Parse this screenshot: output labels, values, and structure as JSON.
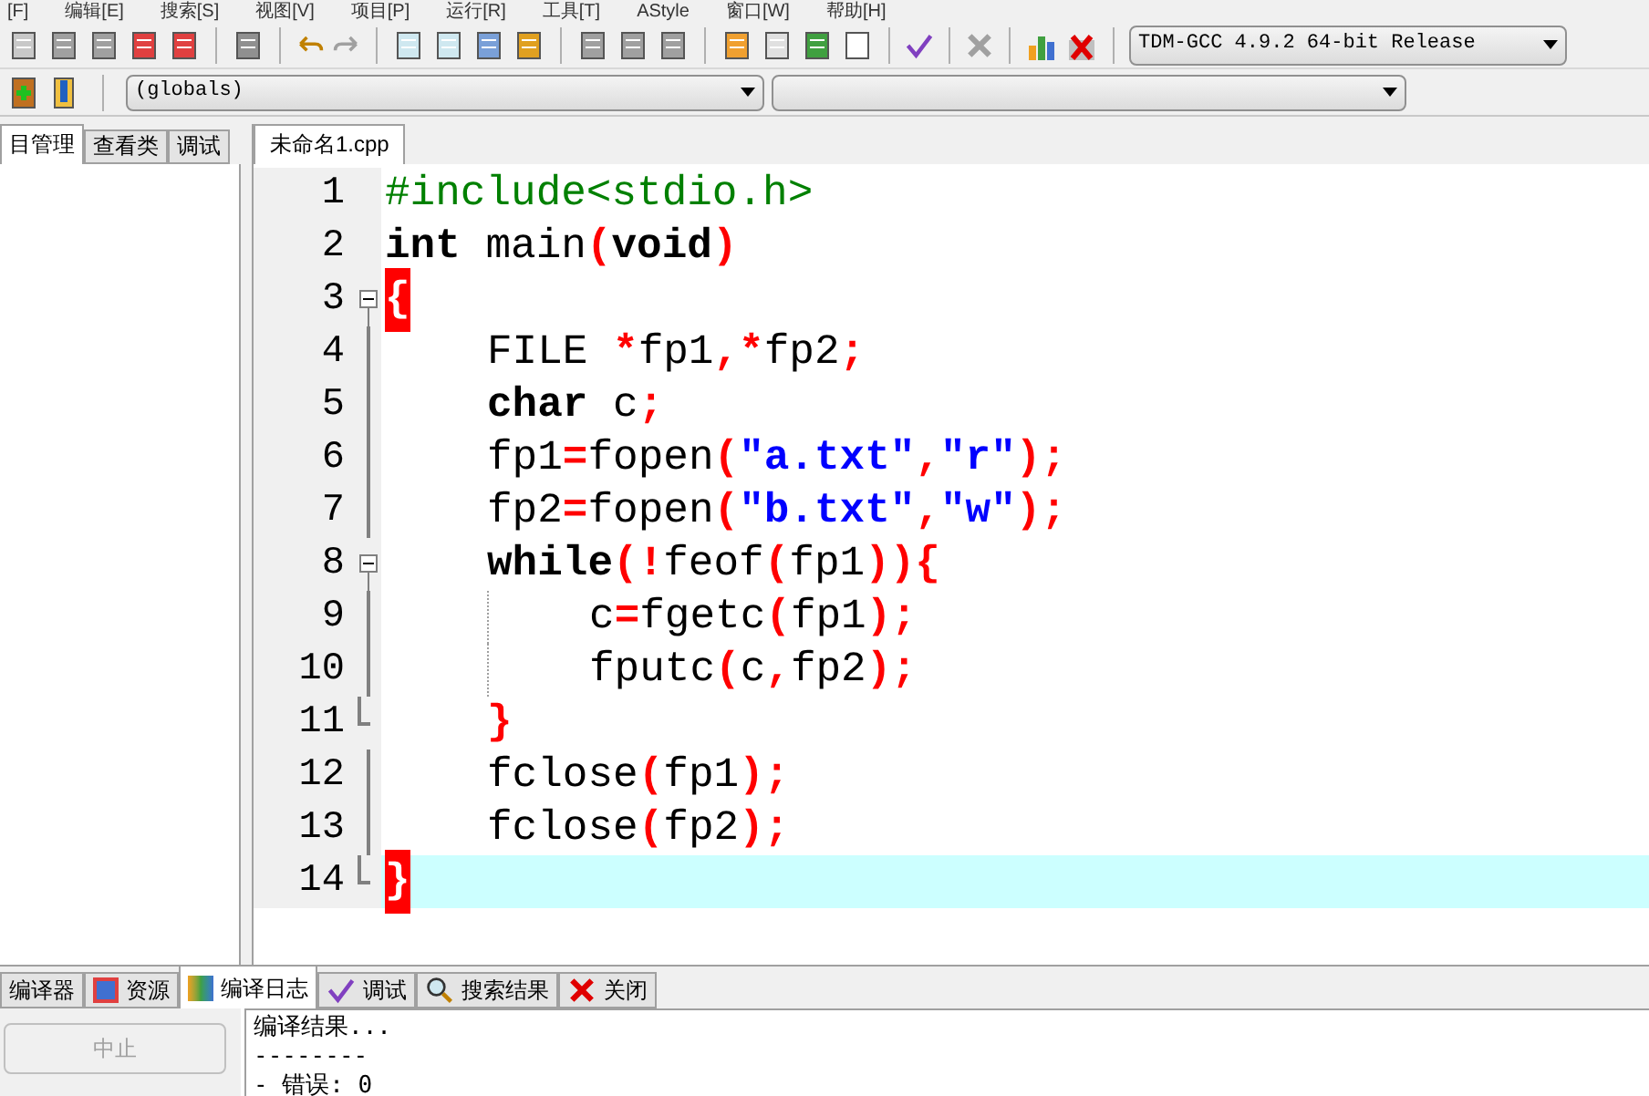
{
  "menu": [
    "[F]",
    "编辑[E]",
    "搜索[S]",
    "视图[V]",
    "项目[P]",
    "运行[R]",
    "工具[T]",
    "AStyle",
    "窗口[W]",
    "帮助[H]"
  ],
  "compiler_select": {
    "value": "TDM-GCC 4.9.2 64-bit Release"
  },
  "scope_select": {
    "value": "(globals)"
  },
  "left_tabs": [
    {
      "label": "目管理",
      "selected": true
    },
    {
      "label": "查看类",
      "selected": false
    },
    {
      "label": "调试",
      "selected": false
    }
  ],
  "editor_tabs": [
    {
      "label": "未命名1.cpp",
      "selected": true
    }
  ],
  "code_lines": [
    {
      "number": "1",
      "kind": "plain",
      "tokens": [
        {
          "kind": "preprocessor",
          "text": "#include<stdio.h>"
        }
      ]
    },
    {
      "number": "2",
      "kind": "plain",
      "tokens": [
        {
          "kind": "keyword",
          "text": "int"
        },
        {
          "kind": "plain",
          "text": " main"
        },
        {
          "kind": "symbol",
          "text": "("
        },
        {
          "kind": "keyword",
          "text": "void"
        },
        {
          "kind": "symbol",
          "text": ")"
        }
      ]
    },
    {
      "number": "3",
      "kind": "fold-start",
      "tokens": [
        {
          "kind": "brace-match",
          "text": "{"
        }
      ]
    },
    {
      "number": "4",
      "kind": "fold-line",
      "tokens": [
        {
          "kind": "plain",
          "text": "FILE "
        },
        {
          "kind": "symbol",
          "text": "*"
        },
        {
          "kind": "plain",
          "text": "fp1"
        },
        {
          "kind": "symbol",
          "text": ",*"
        },
        {
          "kind": "plain",
          "text": "fp2"
        },
        {
          "kind": "symbol",
          "text": ";"
        }
      ]
    },
    {
      "number": "5",
      "kind": "fold-line",
      "tokens": [
        {
          "kind": "keyword",
          "text": "char"
        },
        {
          "kind": "plain",
          "text": " c"
        },
        {
          "kind": "symbol",
          "text": ";"
        }
      ]
    },
    {
      "number": "6",
      "kind": "fold-line",
      "tokens": [
        {
          "kind": "plain",
          "text": "fp1"
        },
        {
          "kind": "symbol",
          "text": "="
        },
        {
          "kind": "plain",
          "text": "fopen"
        },
        {
          "kind": "symbol",
          "text": "("
        },
        {
          "kind": "string",
          "text": "\"a.txt\""
        },
        {
          "kind": "symbol",
          "text": ","
        },
        {
          "kind": "string",
          "text": "\"r\""
        },
        {
          "kind": "symbol",
          "text": ");"
        }
      ]
    },
    {
      "number": "7",
      "kind": "fold-line",
      "tokens": [
        {
          "kind": "plain",
          "text": "fp2"
        },
        {
          "kind": "symbol",
          "text": "="
        },
        {
          "kind": "plain",
          "text": "fopen"
        },
        {
          "kind": "symbol",
          "text": "("
        },
        {
          "kind": "string",
          "text": "\"b.txt\""
        },
        {
          "kind": "symbol",
          "text": ","
        },
        {
          "kind": "string",
          "text": "\"w\""
        },
        {
          "kind": "symbol",
          "text": ");"
        }
      ]
    },
    {
      "number": "8",
      "kind": "fold-start",
      "tokens": [
        {
          "kind": "keyword",
          "text": "while"
        },
        {
          "kind": "symbol",
          "text": "(!"
        },
        {
          "kind": "plain",
          "text": "feof"
        },
        {
          "kind": "symbol",
          "text": "("
        },
        {
          "kind": "plain",
          "text": "fp1"
        },
        {
          "kind": "symbol",
          "text": ")){"
        }
      ]
    },
    {
      "number": "9",
      "kind": "fold-line",
      "tokens": [
        {
          "kind": "plain",
          "text": "c"
        },
        {
          "kind": "symbol",
          "text": "="
        },
        {
          "kind": "plain",
          "text": "fgetc"
        },
        {
          "kind": "symbol",
          "text": "("
        },
        {
          "kind": "plain",
          "text": "fp1"
        },
        {
          "kind": "symbol",
          "text": ");"
        }
      ]
    },
    {
      "number": "10",
      "kind": "fold-line",
      "tokens": [
        {
          "kind": "plain",
          "text": "fputc"
        },
        {
          "kind": "symbol",
          "text": "("
        },
        {
          "kind": "plain",
          "text": "c"
        },
        {
          "kind": "symbol",
          "text": ","
        },
        {
          "kind": "plain",
          "text": "fp2"
        },
        {
          "kind": "symbol",
          "text": ");"
        }
      ]
    },
    {
      "number": "11",
      "kind": "fold-end",
      "tokens": [
        {
          "kind": "symbol",
          "text": "}"
        }
      ]
    },
    {
      "number": "12",
      "kind": "fold-line",
      "tokens": [
        {
          "kind": "plain",
          "text": "fclose"
        },
        {
          "kind": "symbol",
          "text": "("
        },
        {
          "kind": "plain",
          "text": "fp1"
        },
        {
          "kind": "symbol",
          "text": ");"
        }
      ]
    },
    {
      "number": "13",
      "kind": "fold-line",
      "tokens": [
        {
          "kind": "plain",
          "text": "fclose"
        },
        {
          "kind": "symbol",
          "text": "("
        },
        {
          "kind": "plain",
          "text": "fp2"
        },
        {
          "kind": "symbol",
          "text": ");"
        }
      ]
    },
    {
      "number": "14",
      "kind": "fold-end",
      "current": true,
      "tokens": [
        {
          "kind": "brace-match",
          "text": "}"
        }
      ]
    }
  ],
  "abort_button": {
    "label": "中止",
    "disabled": true
  },
  "bottom_tabs": [
    {
      "label": "编译器",
      "selected": false
    },
    {
      "label": "资源",
      "selected": false
    },
    {
      "label": "编译日志",
      "selected": true
    },
    {
      "label": "调试",
      "selected": false
    },
    {
      "label": "搜索结果",
      "selected": false
    },
    {
      "label": "关闭",
      "selected": false
    }
  ],
  "log_lines": [
    "编译结果...",
    "--------",
    "- 错误: 0"
  ]
}
